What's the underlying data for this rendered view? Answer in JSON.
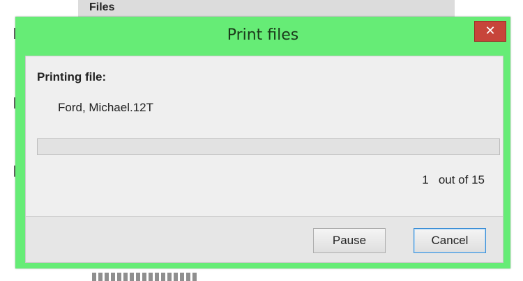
{
  "background": {
    "files_header": "Files"
  },
  "dialog": {
    "title": "Print files",
    "close_glyph": "✕",
    "section_label": "Printing file:",
    "file_name": "Ford, Michael.12T",
    "progress": {
      "current": 1,
      "total": 15,
      "fraction": 0.0,
      "counter_text": "1   out of 15"
    },
    "buttons": {
      "pause": "Pause",
      "cancel": "Cancel"
    }
  },
  "colors": {
    "dialog_frame": "#66ec76",
    "close_button": "#c7453a",
    "cancel_focus": "#3c8fd6"
  },
  "icons": {
    "close": "close-icon"
  }
}
